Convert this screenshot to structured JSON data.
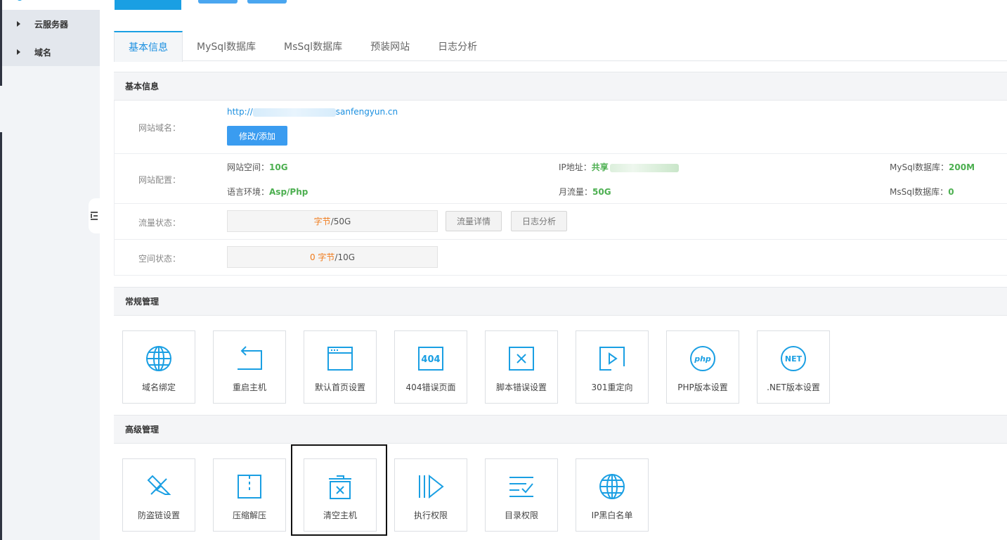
{
  "sidebar": {
    "items": [
      {
        "label": "云服务器"
      },
      {
        "label": "域名"
      }
    ]
  },
  "tabs": [
    {
      "label": "基本信息",
      "active": true
    },
    {
      "label": "MySql数据库",
      "active": false
    },
    {
      "label": "MsSql数据库",
      "active": false
    },
    {
      "label": "预装网站",
      "active": false
    },
    {
      "label": "日志分析",
      "active": false
    }
  ],
  "basic": {
    "title": "基本信息",
    "domain_label": "网站域名：",
    "domain_prefix": "http://",
    "domain_suffix": "sanfengyun.cn",
    "edit_button": "修改/添加",
    "config_label": "网站配置：",
    "space_label": "网站空间：",
    "space_value": "10G",
    "ip_label": "IP地址：",
    "ip_value": "共享",
    "mysql_label": "MySql数据库：",
    "mysql_value": "200M",
    "lang_label": "语言环境：",
    "lang_value": "Asp/Php",
    "traffic_label": "月流量：",
    "traffic_value": "50G",
    "mssql_label": "MsSql数据库：",
    "mssql_value": "0",
    "flow_label": "流量状态：",
    "flow_used": "字节",
    "flow_total": "/50G",
    "flow_detail_button": "流量详情",
    "log_button": "日志分析",
    "space_status_label": "空间状态：",
    "space_used": "0 字节",
    "space_total": "/10G"
  },
  "general": {
    "title": "常规管理",
    "tiles": [
      {
        "label": "域名绑定",
        "icon": "globe-icon"
      },
      {
        "label": "重启主机",
        "icon": "restart-icon"
      },
      {
        "label": "默认首页设置",
        "icon": "browser-window-icon"
      },
      {
        "label": "404错误页面",
        "icon": "404-icon"
      },
      {
        "label": "脚本错误设置",
        "icon": "close-box-icon"
      },
      {
        "label": "301重定向",
        "icon": "play-box-icon"
      },
      {
        "label": "PHP版本设置",
        "icon": "php-icon"
      },
      {
        "label": ".NET版本设置",
        "icon": "net-icon"
      }
    ]
  },
  "advanced": {
    "title": "高级管理",
    "tiles": [
      {
        "label": "防盗链设置",
        "icon": "broken-link-icon"
      },
      {
        "label": "压缩解压",
        "icon": "zip-icon"
      },
      {
        "label": "清空主机",
        "icon": "trash-icon"
      },
      {
        "label": "执行权限",
        "icon": "execute-icon"
      },
      {
        "label": "目录权限",
        "icon": "checklist-icon"
      },
      {
        "label": "IP黑白名单",
        "icon": "globe-icon"
      }
    ]
  },
  "colors": {
    "accent": "#1a9fe3",
    "green": "#4caf50",
    "orange": "#f07a1b"
  }
}
